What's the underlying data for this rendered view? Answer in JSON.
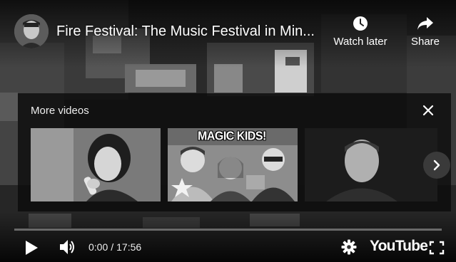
{
  "video": {
    "title": "Fire Festival: The Music Festival in Min...",
    "channel_avatar_icon": "channel-avatar"
  },
  "top_actions": {
    "watch_later_label": "Watch later",
    "watch_later_icon": "clock-icon",
    "share_label": "Share",
    "share_icon": "share-arrow-icon"
  },
  "more_videos": {
    "title": "More videos",
    "close_icon": "close-icon",
    "next_icon": "chevron-right-icon",
    "thumbnails": [
      {
        "overlay_text": ""
      },
      {
        "overlay_text": "MAGIC KIDS!"
      },
      {
        "overlay_text": ""
      }
    ]
  },
  "controls": {
    "current_time": "0:00",
    "separator": "/",
    "duration": "17:56",
    "progress": 0,
    "logo_text": "YouTube",
    "play_icon": "play-icon",
    "volume_icon": "volume-icon",
    "settings_icon": "gear-icon",
    "fullscreen_icon": "fullscreen-icon"
  },
  "colors": {
    "overlay_panel": "#0c0c0c",
    "text": "#ffffff",
    "progress_track": "#8a8a8a"
  }
}
